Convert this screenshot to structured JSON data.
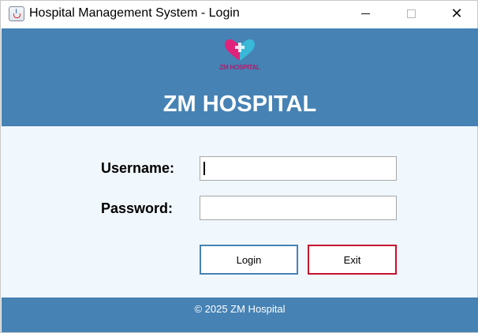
{
  "window": {
    "title": "Hospital Management System - Login",
    "minimize_icon": "minimize-icon",
    "maximize_icon": "maximize-icon",
    "close_symbol": "✕"
  },
  "header": {
    "logo_text": "ZM HOSPITAL",
    "title": "ZM HOSPITAL"
  },
  "form": {
    "username_label": "Username:",
    "username_value": "",
    "password_label": "Password:",
    "password_value": "",
    "login_label": "Login",
    "exit_label": "Exit"
  },
  "footer": {
    "text": "© 2025 ZM Hospital"
  },
  "colors": {
    "header_bg": "#4682b4",
    "body_bg": "#f0f7fd",
    "login_border": "#4682b4",
    "exit_border": "#c8102e",
    "logo_accent": "#b21a6b"
  }
}
